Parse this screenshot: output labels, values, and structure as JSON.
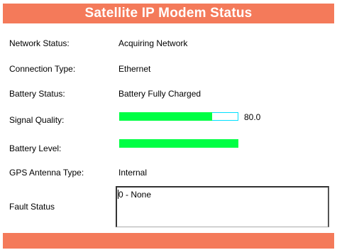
{
  "header": {
    "title": "Satellite IP Modem Status"
  },
  "rows": {
    "network_status": {
      "label": "Network Status:",
      "value": "Acquiring Network"
    },
    "connection_type": {
      "label": "Connection Type:",
      "value": "Ethernet"
    },
    "battery_status": {
      "label": "Battery Status:",
      "value": "Battery Fully Charged"
    },
    "signal_quality": {
      "label": "Signal  Quality:",
      "value": "80.0",
      "fraction": 0.78
    },
    "battery_level": {
      "label": "Battery Level:",
      "fraction": 1.0
    },
    "gps_antenna_type": {
      "label": "GPS Antenna Type:",
      "value": "Internal"
    },
    "fault_status": {
      "label": "Fault Status",
      "value": "0 - None"
    }
  },
  "colors": {
    "accent": "#f47a5a",
    "bar_fill": "#00ff44",
    "signal_border": "#00e0ff"
  }
}
